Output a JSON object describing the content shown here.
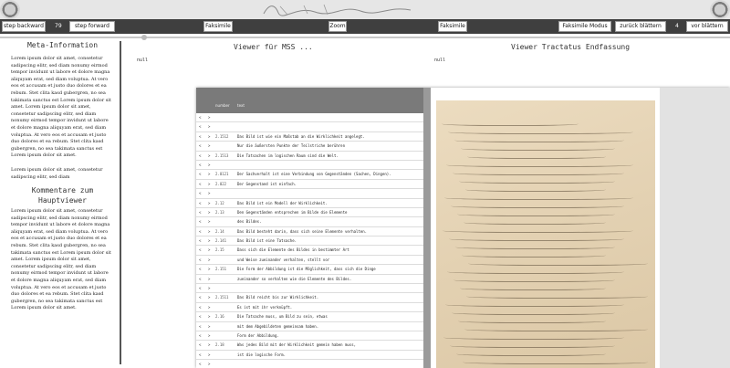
{
  "header": {
    "left_seal_icon": "seal-icon",
    "right_seal_icon": "seal-icon",
    "signature_text": "L. Wittgenstein"
  },
  "toolbar": {
    "step_backward": "step backward",
    "page_number_left": "79",
    "step_forward": "step forward",
    "faksimile_left": "Faksimile",
    "zoom": "Zoom",
    "faksimile_right": "Faksimile",
    "faksimile_modus": "Faksimile Modus",
    "zurueck_blaettern": "zurück blättern",
    "page_number_right": "4",
    "vor_blaettern": "vor blättern"
  },
  "meta": {
    "title": "Meta-Information",
    "paragraph1": "Lorem ipsum dolor sit amet, consetetur sadipscing elitr, sed diam nonumy eirmod tempor invidunt ut labore et dolore magna aliquyam erat, sed diam voluptua. At vero eos et accusam et justo duo dolores et ea rebum. Stet clita kasd gubergren, no sea takimata sanctus est Lorem ipsum dolor sit amet. Lorem ipsum dolor sit amet, consetetur sadipscing elitr, sed diam nonumy eirmod tempor invidunt ut labore et dolore magna aliquyam erat, sed diam voluptua. At vero eos et accusam et justo duo dolores et ea rebum. Stet clita kasd gubergren, no sea takimata sanctus est Lorem ipsum dolor sit amet.",
    "paragraph2": "Lorem ipsum dolor sit amet, consetetur sadipscing elitr, sed diam"
  },
  "kommentare": {
    "title": "Kommentare zum Hauptviewer",
    "paragraph": "Lorem ipsum dolor sit amet, consetetur sadipscing elitr, sed diam nonumy eirmod tempor invidunt ut labore et dolore magna aliquyam erat, sed diam voluptua. At vero eos et accusam et justo duo dolores et ea rebum. Stet clita kasd gubergren, no sea takimata sanctus est Lorem ipsum dolor sit amet. Lorem ipsum dolor sit amet, consetetur sadipscing elitr, sed diam nonumy eirmod tempor invidunt ut labore et dolore magna aliquyam erat, sed diam voluptua. At vero eos et accusam et justo duo dolores et ea rebum. Stet clita kasd gubergren, no sea takimata sanctus est Lorem ipsum dolor sit amet."
  },
  "viewer_mss": {
    "title": "Viewer für MSS ...",
    "null_text": "null"
  },
  "viewer_tractatus": {
    "title": "Viewer Tractatus Endfassung",
    "null_text": "null"
  },
  "text_table": {
    "header_number": "number",
    "header_text": "text",
    "rows": [
      {
        "a": "<",
        "b": ">",
        "num": "",
        "text": ""
      },
      {
        "a": "<",
        "b": ">",
        "num": "",
        "text": ""
      },
      {
        "a": "<",
        "b": ">",
        "num": "2.1512",
        "text": "Das Bild ist wie ein Maßstab an die Wirklichkeit angelegt."
      },
      {
        "a": "<",
        "b": ">",
        "num": "",
        "text": "Nur die äußersten Punkte der Teilstriche berühren"
      },
      {
        "a": "<",
        "b": ">",
        "num": "2.1513",
        "text": "Die Tatsachen im logischen Raum sind die Welt."
      },
      {
        "a": "<",
        "b": ">",
        "num": "",
        "text": ""
      },
      {
        "a": "<",
        "b": ">",
        "num": "2.0121",
        "text": "Der Sachverhalt ist eine Verbindung von Gegenständen (Sachen, Dingen)."
      },
      {
        "a": "<",
        "b": ">",
        "num": "2.022",
        "text": "Der Gegenstand ist einfach."
      },
      {
        "a": "<",
        "b": ">",
        "num": "",
        "text": ""
      },
      {
        "a": "<",
        "b": ">",
        "num": "2.12",
        "text": "Das Bild ist ein Modell der Wirklichkeit."
      },
      {
        "a": "<",
        "b": ">",
        "num": "2.13",
        "text": "Den Gegenständen entsprechen im Bilde die Elemente"
      },
      {
        "a": "<",
        "b": ">",
        "num": "",
        "text": "des Bildes."
      },
      {
        "a": "<",
        "b": ">",
        "num": "2.14",
        "text": "Das Bild besteht darin, dass sich seine Elemente verhalten."
      },
      {
        "a": "<",
        "b": ">",
        "num": "2.141",
        "text": "Das Bild ist eine Tatsache."
      },
      {
        "a": "<",
        "b": ">",
        "num": "2.15",
        "text": "Dass sich die Elemente des Bildes in bestimmter Art"
      },
      {
        "a": "<",
        "b": ">",
        "num": "",
        "text": "und Weise zueinander verhalten, stellt vor"
      },
      {
        "a": "<",
        "b": ">",
        "num": "2.151",
        "text": "Die Form der Abbildung ist die Möglichkeit, dass sich die Dinge"
      },
      {
        "a": "<",
        "b": ">",
        "num": "",
        "text": "zueinander so verhalten wie die Elemente des Bildes."
      },
      {
        "a": "<",
        "b": ">",
        "num": "",
        "text": ""
      },
      {
        "a": "<",
        "b": ">",
        "num": "2.1511",
        "text": "Das Bild reicht bis zur Wirklichkeit."
      },
      {
        "a": "<",
        "b": ">",
        "num": "",
        "text": "Es ist mit ihr verknüpft."
      },
      {
        "a": "<",
        "b": ">",
        "num": "2.16",
        "text": "Die Tatsache muss, um Bild zu sein, etwas"
      },
      {
        "a": "<",
        "b": ">",
        "num": "",
        "text": "mit dem Abgebildeten gemeinsam haben."
      },
      {
        "a": "<",
        "b": ">",
        "num": "",
        "text": "Form der Abbildung."
      },
      {
        "a": "<",
        "b": ">",
        "num": "2.18",
        "text": "Was jedes Bild mit der Wirklichkeit gemein haben muss,"
      },
      {
        "a": "<",
        "b": ">",
        "num": "",
        "text": "ist die logische Form."
      },
      {
        "a": "<",
        "b": ">",
        "num": "",
        "text": ""
      }
    ]
  }
}
